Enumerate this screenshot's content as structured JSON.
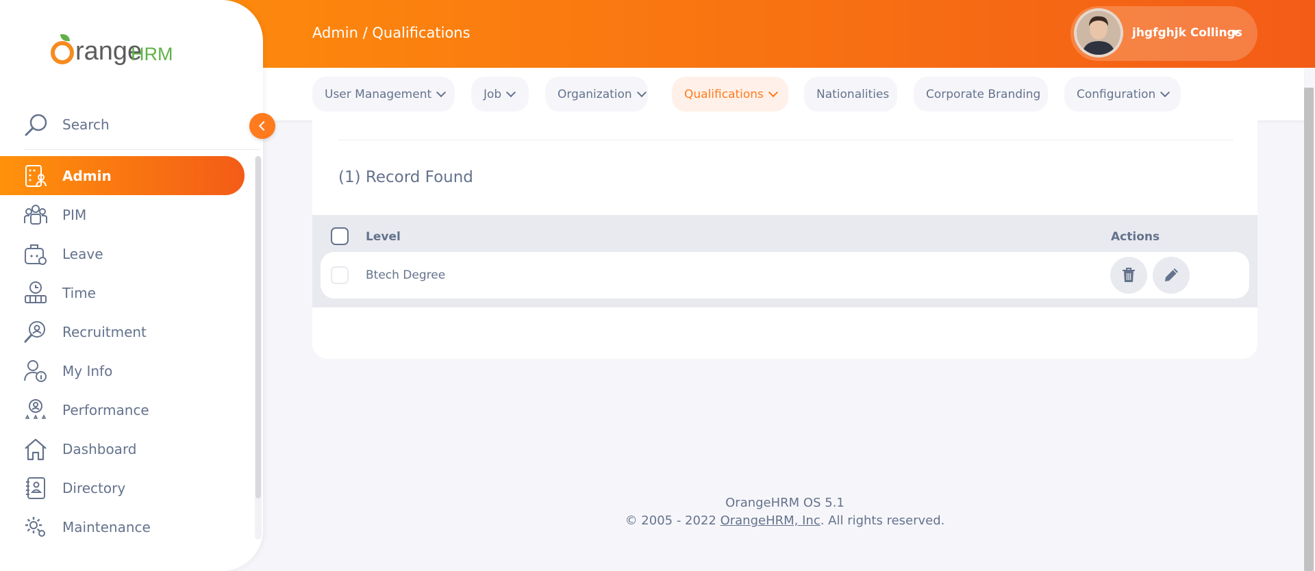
{
  "header": {
    "breadcrumb": "Admin / Qualifications",
    "user_name": "jhgfghjk Collings"
  },
  "nav_tabs": [
    {
      "label": "User Management",
      "has_dropdown": true,
      "active": false
    },
    {
      "label": "Job",
      "has_dropdown": true,
      "active": false
    },
    {
      "label": "Organization",
      "has_dropdown": true,
      "active": false
    },
    {
      "label": "Qualifications",
      "has_dropdown": true,
      "active": true
    },
    {
      "label": "Nationalities",
      "has_dropdown": false,
      "active": false
    },
    {
      "label": "Corporate Branding",
      "has_dropdown": false,
      "active": false
    },
    {
      "label": "Configuration",
      "has_dropdown": true,
      "active": true
    }
  ],
  "sidebar": {
    "logo_text_1": "range",
    "logo_text_2": "HRM",
    "search_label": "Search",
    "items": [
      {
        "label": "Admin",
        "icon": "admin-icon",
        "active": true
      },
      {
        "label": "PIM",
        "icon": "pim-icon",
        "active": false
      },
      {
        "label": "Leave",
        "icon": "leave-icon",
        "active": false
      },
      {
        "label": "Time",
        "icon": "time-icon",
        "active": false
      },
      {
        "label": "Recruitment",
        "icon": "recruitment-icon",
        "active": false
      },
      {
        "label": "My Info",
        "icon": "myinfo-icon",
        "active": false
      },
      {
        "label": "Performance",
        "icon": "performance-icon",
        "active": false
      },
      {
        "label": "Dashboard",
        "icon": "dashboard-icon",
        "active": false
      },
      {
        "label": "Directory",
        "icon": "directory-icon",
        "active": false
      },
      {
        "label": "Maintenance",
        "icon": "maintenance-icon",
        "active": false
      }
    ]
  },
  "content": {
    "records_found": "(1) Record Found",
    "columns": {
      "level": "Level",
      "actions": "Actions"
    },
    "rows": [
      {
        "level": "Btech Degree"
      }
    ]
  },
  "footer": {
    "version": "OrangeHRM OS 5.1",
    "copyright_prefix": "© 2005 - 2022 ",
    "company_link": "OrangeHRM, Inc",
    "copyright_suffix": ". All rights reserved."
  },
  "colors": {
    "accent": "#ff7b1d",
    "gradient_start": "#ff920b",
    "gradient_end": "#f35c17",
    "text": "#64728c",
    "brand_green": "#5fb147"
  }
}
